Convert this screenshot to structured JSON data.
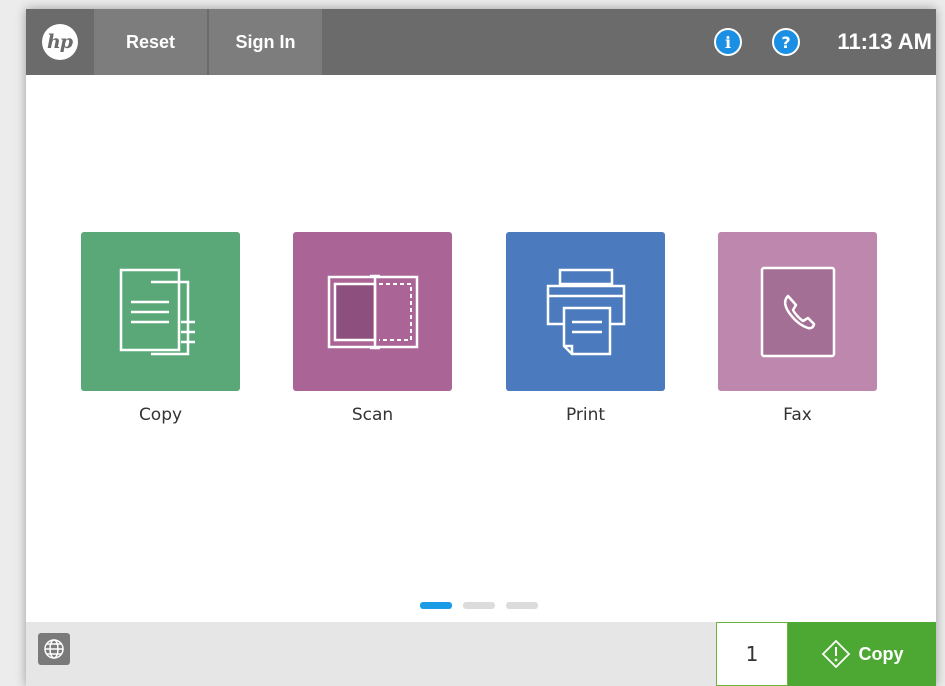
{
  "header": {
    "logo_text": "hp",
    "reset_label": "Reset",
    "signin_label": "Sign In",
    "info_glyph": "i",
    "help_glyph": "?",
    "time": "11:13 AM",
    "bar_color": "#6b6b6b",
    "button_color": "#7d7d7d",
    "icon_color": "#1a8fe3"
  },
  "apps": [
    {
      "label": "Copy",
      "icon": "copy-icon",
      "color": "#5aa878"
    },
    {
      "label": "Scan",
      "icon": "scan-icon",
      "color": "#aa6496"
    },
    {
      "label": "Print",
      "icon": "print-icon",
      "color": "#4b7bbe"
    },
    {
      "label": "Fax",
      "icon": "fax-icon",
      "color": "#be87ae"
    }
  ],
  "pager": {
    "pages": 3,
    "active": 1,
    "active_color": "#1a9be6",
    "inactive_color": "#dcdcdc"
  },
  "footer": {
    "globe_icon": "globe-icon",
    "copies_value": "1",
    "start_label": "Copy",
    "start_icon": "start-diamond-icon",
    "start_color": "#4ca832"
  }
}
